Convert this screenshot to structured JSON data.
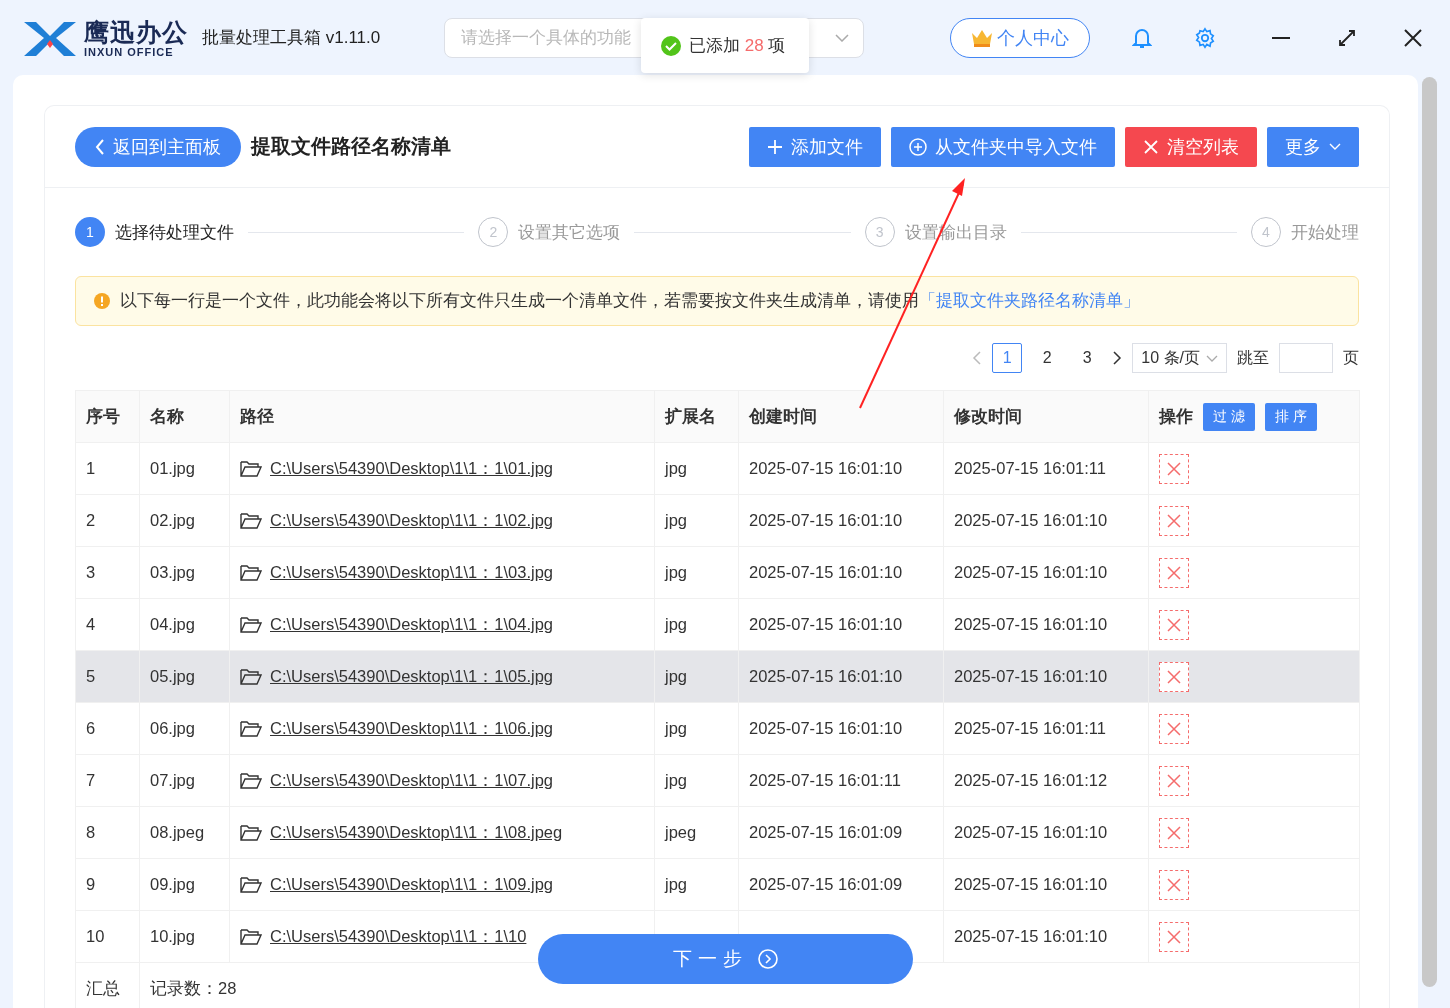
{
  "app": {
    "logo_name": "鹰迅办公",
    "logo_sub": "INXUN OFFICE",
    "title": "批量处理工具箱 v1.11.0"
  },
  "search": {
    "placeholder": "请选择一个具体的功能"
  },
  "toast": {
    "before": "已添加",
    "count": "28",
    "after": "项"
  },
  "user_button": "个人中心",
  "toolbar": {
    "back": "返回到主面板",
    "title": "提取文件路径名称清单",
    "buttons": [
      {
        "kind": "add",
        "label": "添加文件"
      },
      {
        "kind": "import",
        "label": "从文件夹中导入文件"
      },
      {
        "kind": "clear",
        "label": "清空列表"
      },
      {
        "kind": "more",
        "label": "更多"
      }
    ]
  },
  "steps": [
    {
      "number": "1",
      "label": "选择待处理文件",
      "selected": true
    },
    {
      "number": "2",
      "label": "设置其它选项",
      "selected": false
    },
    {
      "number": "3",
      "label": "设置输出目录",
      "selected": false
    },
    {
      "number": "4",
      "label": "开始处理",
      "selected": false
    }
  ],
  "notice": {
    "text": "以下每一行是一个文件，此功能会将以下所有文件只生成一个清单文件，若需要按文件夹生成清单，请使用",
    "link": "「提取文件夹路径名称清单」"
  },
  "pagination": {
    "pages": [
      {
        "label": "1",
        "selected": true
      },
      {
        "label": "2",
        "selected": false
      },
      {
        "label": "3",
        "selected": false
      }
    ],
    "page_size": "10 条/页",
    "jump_label": "跳至",
    "page_suffix": "页"
  },
  "table": {
    "columns": [
      "序号",
      "名称",
      "路径",
      "扩展名",
      "创建时间",
      "修改时间",
      "操作"
    ],
    "filter_button": "过 滤",
    "sort_button": "排 序",
    "rows": [
      {
        "index": "1",
        "name": "01.jpg",
        "path": "C:\\Users\\54390\\Desktop\\1\\1：1\\01.jpg",
        "ext": "jpg",
        "created": "2025-07-15 16:01:10",
        "modified": "2025-07-15 16:01:11",
        "hovered": false
      },
      {
        "index": "2",
        "name": "02.jpg",
        "path": "C:\\Users\\54390\\Desktop\\1\\1：1\\02.jpg",
        "ext": "jpg",
        "created": "2025-07-15 16:01:10",
        "modified": "2025-07-15 16:01:10",
        "hovered": false
      },
      {
        "index": "3",
        "name": "03.jpg",
        "path": "C:\\Users\\54390\\Desktop\\1\\1：1\\03.jpg",
        "ext": "jpg",
        "created": "2025-07-15 16:01:10",
        "modified": "2025-07-15 16:01:10",
        "hovered": false
      },
      {
        "index": "4",
        "name": "04.jpg",
        "path": "C:\\Users\\54390\\Desktop\\1\\1：1\\04.jpg",
        "ext": "jpg",
        "created": "2025-07-15 16:01:10",
        "modified": "2025-07-15 16:01:10",
        "hovered": false
      },
      {
        "index": "5",
        "name": "05.jpg",
        "path": "C:\\Users\\54390\\Desktop\\1\\1：1\\05.jpg",
        "ext": "jpg",
        "created": "2025-07-15 16:01:10",
        "modified": "2025-07-15 16:01:10",
        "hovered": true
      },
      {
        "index": "6",
        "name": "06.jpg",
        "path": "C:\\Users\\54390\\Desktop\\1\\1：1\\06.jpg",
        "ext": "jpg",
        "created": "2025-07-15 16:01:10",
        "modified": "2025-07-15 16:01:11",
        "hovered": false
      },
      {
        "index": "7",
        "name": "07.jpg",
        "path": "C:\\Users\\54390\\Desktop\\1\\1：1\\07.jpg",
        "ext": "jpg",
        "created": "2025-07-15 16:01:11",
        "modified": "2025-07-15 16:01:12",
        "hovered": false
      },
      {
        "index": "8",
        "name": "08.jpeg",
        "path": "C:\\Users\\54390\\Desktop\\1\\1：1\\08.jpeg",
        "ext": "jpeg",
        "created": "2025-07-15 16:01:09",
        "modified": "2025-07-15 16:01:10",
        "hovered": false
      },
      {
        "index": "9",
        "name": "09.jpg",
        "path": "C:\\Users\\54390\\Desktop\\1\\1：1\\09.jpg",
        "ext": "jpg",
        "created": "2025-07-15 16:01:09",
        "modified": "2025-07-15 16:01:10",
        "hovered": false
      },
      {
        "index": "10",
        "name": "10.jpg",
        "path": "C:\\Users\\54390\\Desktop\\1\\1：1\\10",
        "modified": "2025-07-15 16:01:10",
        "hovered": false
      }
    ],
    "summary": {
      "label": "汇总",
      "count": "记录数：28"
    }
  },
  "next_button": "下一步"
}
